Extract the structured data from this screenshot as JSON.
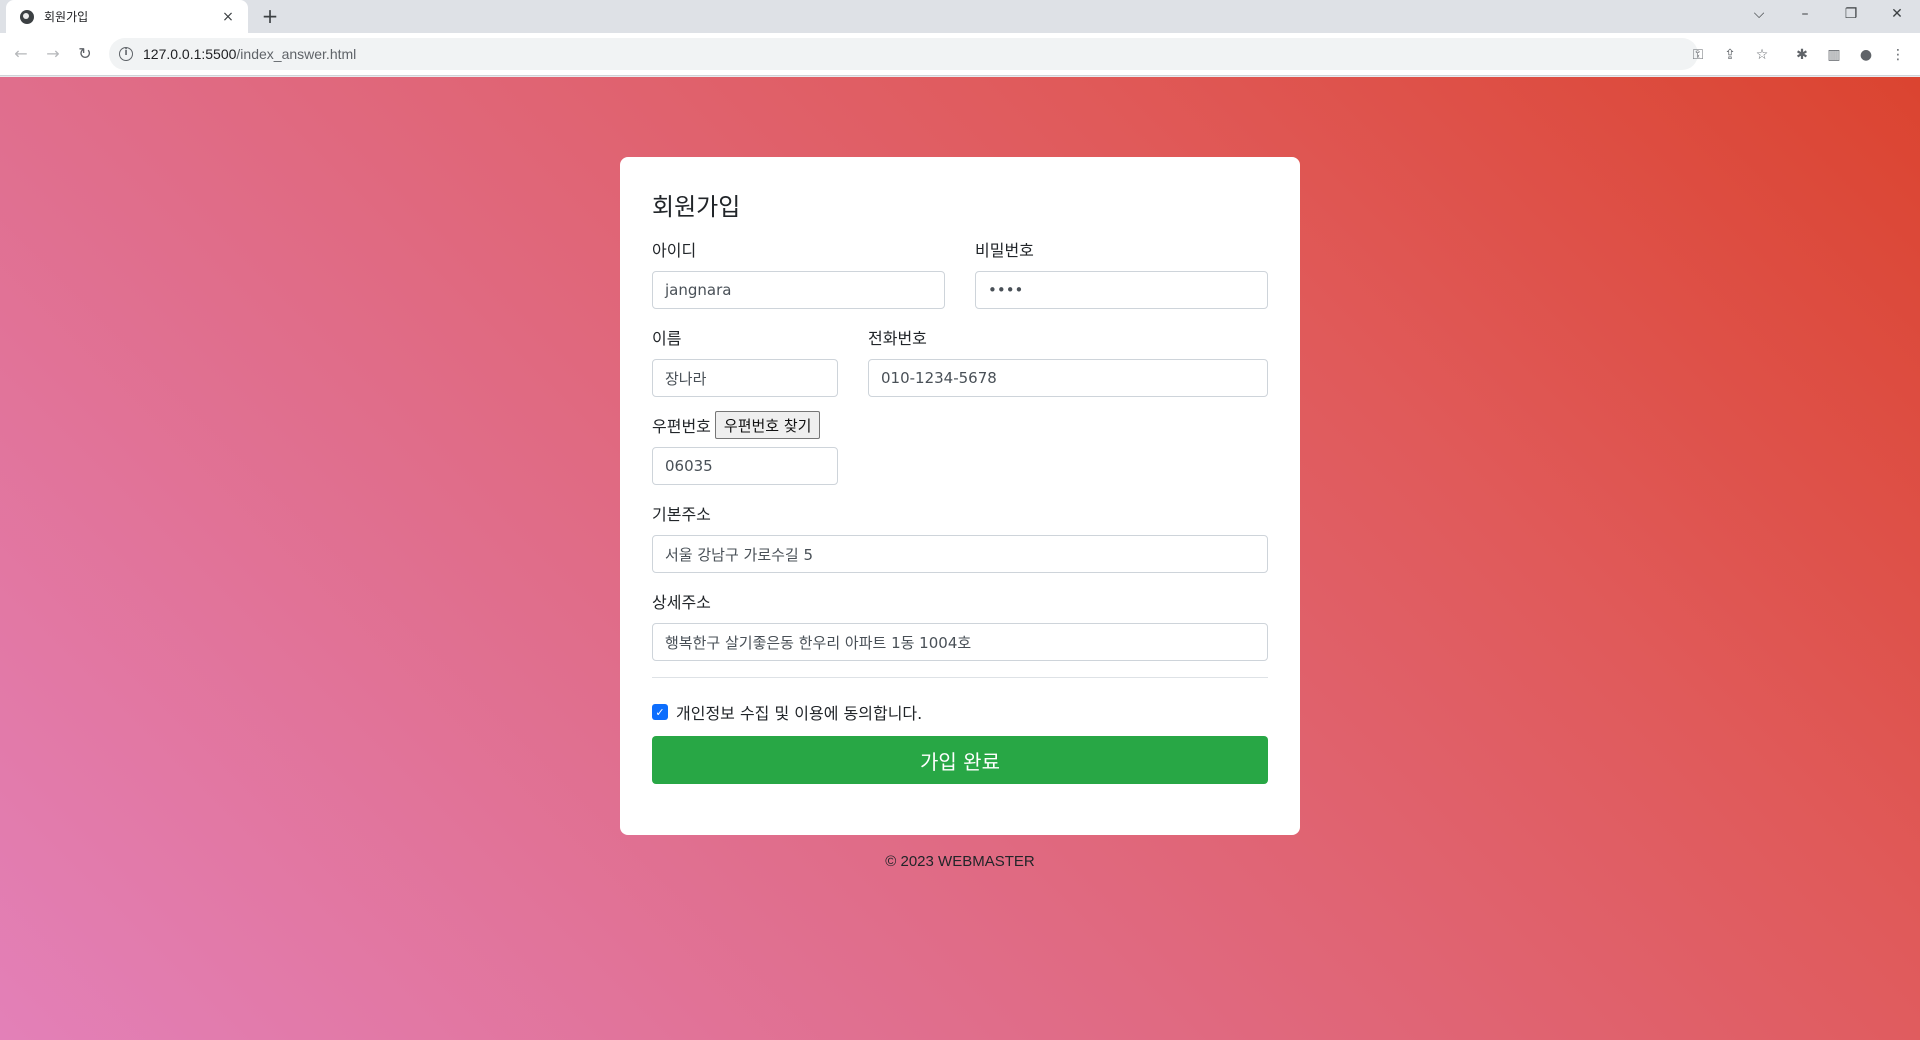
{
  "browser": {
    "tab_title": "회원가입",
    "tab_close": "×",
    "new_tab": "+",
    "url_host": "127.0.0.1:5500",
    "url_path": "/index_answer.html",
    "window_controls": {
      "dropdown": "⌵",
      "minimize": "–",
      "restore": "❐",
      "close": "✕"
    },
    "nav": {
      "back": "←",
      "forward": "→",
      "reload": "↻"
    },
    "toolbar_icons": {
      "key": "⚿",
      "share": "⇪",
      "star": "☆",
      "extensions": "✱",
      "sidepanel": "▥",
      "profile": "●",
      "menu": "⋮"
    }
  },
  "form": {
    "title": "회원가입",
    "id_label": "아이디",
    "id_value": "jangnara",
    "password_label": "비밀번호",
    "password_value": "••••",
    "name_label": "이름",
    "name_value": "장나라",
    "phone_label": "전화번호",
    "phone_value": "010-1234-5678",
    "postcode_label": "우편번호",
    "postcode_button": "우편번호 찾기",
    "postcode_value": "06035",
    "address_label": "기본주소",
    "address_value": "서울 강남구 가로수길 5",
    "detail_label": "상세주소",
    "detail_value": "행복한구 살기좋은동 한우리 아파트 1동 1004호",
    "agree_label": "개인정보 수집 및 이용에 동의합니다.",
    "agree_checked": true,
    "submit_label": "가입 완료"
  },
  "footer": {
    "text": "© 2023 WEBMASTER"
  },
  "colors": {
    "submit": "#28a745",
    "checkbox": "#0d6efd",
    "gradient_start": "#e380b8",
    "gradient_end": "#db4430"
  }
}
